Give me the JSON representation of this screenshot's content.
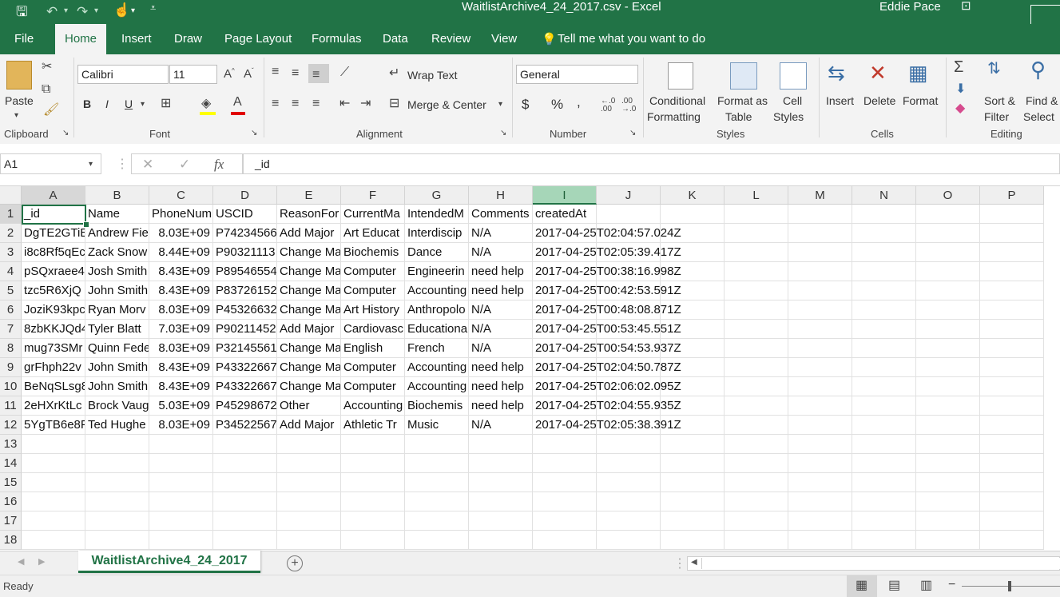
{
  "window": {
    "title": "WaitlistArchive4_24_2017.csv  -  Excel",
    "user": "Eddie Pace"
  },
  "tabs": [
    "File",
    "Home",
    "Insert",
    "Draw",
    "Page Layout",
    "Formulas",
    "Data",
    "Review",
    "View"
  ],
  "tell_me": "Tell me what you want to do",
  "ribbon": {
    "clipboard": {
      "paste": "Paste",
      "label": "Clipboard"
    },
    "font": {
      "name": "Calibri",
      "size": "11",
      "label": "Font",
      "bold": "B",
      "italic": "I",
      "underline": "U"
    },
    "alignment": {
      "wrap": "Wrap Text",
      "merge": "Merge & Center",
      "label": "Alignment"
    },
    "number": {
      "format": "General",
      "label": "Number",
      "currency": "$",
      "percent": "%",
      "comma": ",",
      "inc_dec": ".00→.0",
      "dec_dec": ".0→.00"
    },
    "styles": {
      "conditional": "Conditional",
      "conditional2": "Formatting",
      "format_as": "Format as",
      "format_as2": "Table",
      "cell": "Cell",
      "cell2": "Styles",
      "label": "Styles"
    },
    "cells": {
      "insert": "Insert",
      "delete": "Delete",
      "format": "Format",
      "label": "Cells"
    },
    "editing": {
      "sort": "Sort &",
      "sort2": "Filter",
      "find": "Find &",
      "find2": "Select",
      "label": "Editing"
    }
  },
  "formula_bar": {
    "name_box": "A1",
    "fx": "fx",
    "content": "_id"
  },
  "columns": [
    "A",
    "B",
    "C",
    "D",
    "E",
    "F",
    "G",
    "H",
    "I",
    "J",
    "K",
    "L",
    "M",
    "N",
    "O",
    "P"
  ],
  "row_numbers": [
    "1",
    "2",
    "3",
    "4",
    "5",
    "6",
    "7",
    "8",
    "9",
    "10",
    "11",
    "12",
    "13",
    "14",
    "15",
    "16",
    "17",
    "18"
  ],
  "rows": [
    [
      "_id",
      "Name",
      "PhoneNum",
      "USCID",
      "ReasonFor",
      "CurrentMa",
      "IntendedM",
      "Comments",
      "createdAt"
    ],
    [
      "DgTE2GTiE",
      "Andrew Fie",
      "8.03E+09",
      "P74234566",
      "Add Major",
      "Art Educat",
      "Interdiscip",
      "N/A",
      "2017-04-25T02:04:57.024Z"
    ],
    [
      "i8c8Rf5qEc",
      "Zack Snow",
      "8.44E+09",
      "P90321113",
      "Change Ma",
      "Biochemis",
      "Dance",
      "N/A",
      "2017-04-25T02:05:39.417Z"
    ],
    [
      "pSQxraee4",
      "Josh Smith",
      "8.43E+09",
      "P89546554",
      "Change Ma",
      "Computer",
      "Engineerin",
      "need help",
      "2017-04-25T00:38:16.998Z"
    ],
    [
      "tzc5R6XjQ",
      "John Smith",
      "8.43E+09",
      "P83726152",
      "Change Ma",
      "Computer",
      "Accounting",
      "need help",
      "2017-04-25T00:42:53.591Z"
    ],
    [
      "JoziK93kpc",
      "Ryan Morv",
      "8.03E+09",
      "P45326632",
      "Change Ma",
      "Art History",
      "Anthropolo",
      "N/A",
      "2017-04-25T00:48:08.871Z"
    ],
    [
      "8zbKKJQd4",
      "Tyler Blatt",
      "7.03E+09",
      "P90211452",
      "Add Major",
      "Cardiovasc",
      "Educationa",
      "N/A",
      "2017-04-25T00:53:45.551Z"
    ],
    [
      "mug73SMr",
      "Quinn Fede",
      "8.03E+09",
      "P32145561",
      "Change Ma",
      "English",
      "French",
      "N/A",
      "2017-04-25T00:54:53.937Z"
    ],
    [
      "grFhph22v",
      "John Smith",
      "8.43E+09",
      "P43322667",
      "Change Ma",
      "Computer",
      "Accounting",
      "need help",
      "2017-04-25T02:04:50.787Z"
    ],
    [
      "BeNqSLsg8",
      "John Smith",
      "8.43E+09",
      "P43322667",
      "Change Ma",
      "Computer",
      "Accounting",
      "need help",
      "2017-04-25T02:06:02.095Z"
    ],
    [
      "2eHXrKtLc",
      "Brock Vaug",
      "5.03E+09",
      "P45298672",
      "Other",
      "Accounting",
      "Biochemis",
      "need help",
      "2017-04-25T02:04:55.935Z"
    ],
    [
      "5YgTB6e8F",
      "Ted Hughe",
      "8.03E+09",
      "P34522567",
      "Add Major",
      "Athletic Tr",
      "Music",
      "N/A",
      "2017-04-25T02:05:38.391Z"
    ]
  ],
  "sheet_tab": "WaitlistArchive4_24_2017",
  "status": "Ready",
  "colors": {
    "brand": "#217346",
    "selected_header": "#a6d6b8"
  }
}
